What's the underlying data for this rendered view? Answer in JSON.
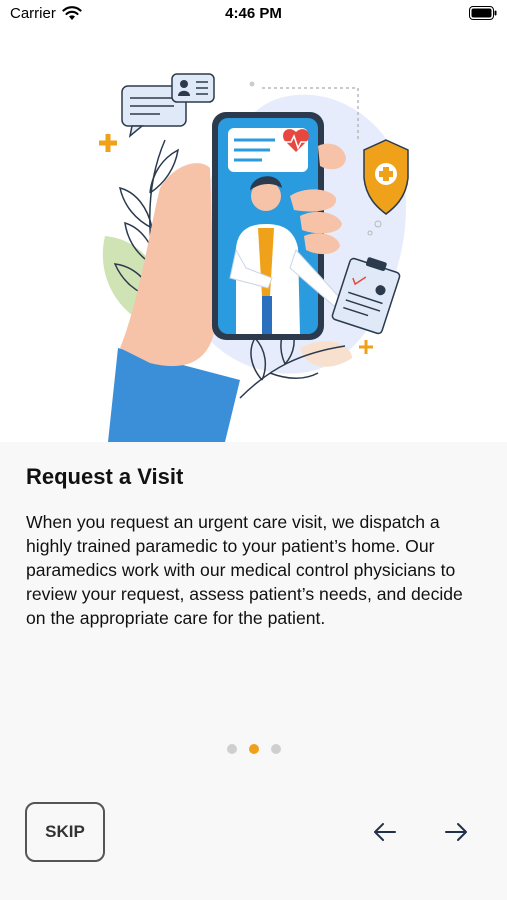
{
  "status_bar": {
    "carrier": "Carrier",
    "time": "4:46 PM"
  },
  "onboarding": {
    "title": "Request a Visit",
    "description": "When you request an urgent care visit, we dispatch a highly trained paramedic to your patient’s home. Our paramedics work with our medical control physicians to review your request, assess patient’s needs, and decide on the appropriate care for the patient.",
    "pages_total": 3,
    "current_page": 2
  },
  "controls": {
    "skip_label": "SKIP",
    "prev_icon": "arrow-left-icon",
    "next_icon": "arrow-right-icon"
  },
  "colors": {
    "accent": "#f0a11a",
    "phone": "#2b9be0",
    "sleeve": "#3b8fd9",
    "skin": "#f6c3a8"
  }
}
